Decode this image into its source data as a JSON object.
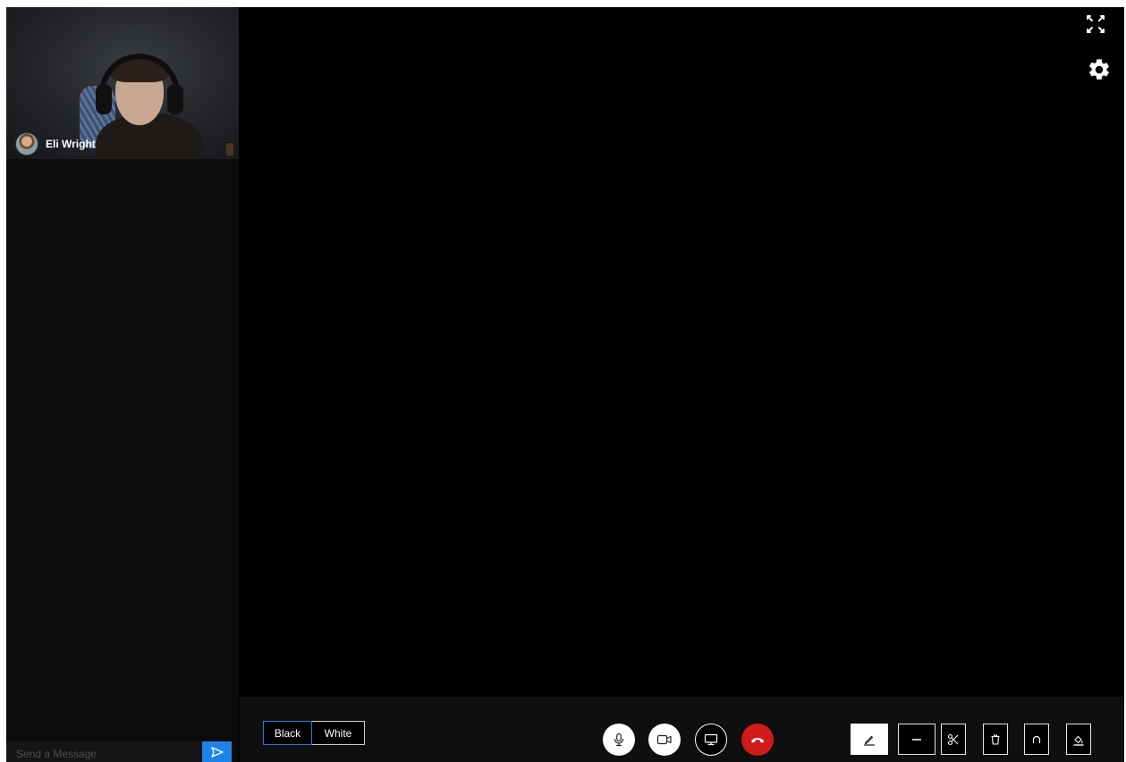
{
  "participant": {
    "name": "Eli Wright"
  },
  "chat": {
    "placeholder": "Send a Message"
  },
  "board_toggle": {
    "black_label": "Black",
    "white_label": "White",
    "selected": "Black"
  },
  "call_controls": [
    "microphone-icon",
    "camera-icon",
    "screen-share-icon",
    "hang-up-icon"
  ],
  "draw_tools": [
    "pencil-icon",
    "line-icon",
    "scissors-icon",
    "trash-icon",
    "undo-icon",
    "fill-icon"
  ],
  "colors": {
    "accent": "#1d83e8",
    "hangup": "#d11a1a",
    "background": "#000000"
  }
}
